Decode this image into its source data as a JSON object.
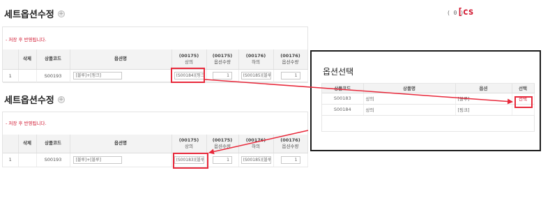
{
  "section_top": {
    "title": "세트옵션수정",
    "counter": "( 0 )",
    "cs_label": "[cs",
    "notice": "- 저장 후 반영됩니다.",
    "headers": {
      "delete": "삭제",
      "product_code": "상품코드",
      "option_name": "옵션명",
      "top_code": "(00175)",
      "top_label": "상의",
      "top_qty_code": "(00175)",
      "top_qty_label": "옵션수량",
      "bottom_code": "(00176)",
      "bottom_label": "하의",
      "bottom_qty_code": "(00176)",
      "bottom_qty_label": "옵션수량"
    },
    "row": {
      "no": "1",
      "product_code": "S00193",
      "option_value": "[블루]+[핑크]",
      "top_select": "(S00184)[핑크]",
      "top_qty": "1",
      "bottom_select": "(S00185)[블루]",
      "bottom_qty": "1"
    }
  },
  "section_bottom": {
    "title": "세트옵션수정",
    "notice": "- 저장 후 반영됩니다.",
    "headers": {
      "delete": "삭제",
      "product_code": "상품코드",
      "option_name": "옵션명",
      "top_code": "(00175)",
      "top_label": "상의",
      "top_qty_code": "(00175)",
      "top_qty_label": "옵션수량",
      "bottom_code": "(00176)",
      "bottom_label": "하의",
      "bottom_qty_code": "(00176)",
      "bottom_qty_label": "옵션수량"
    },
    "row": {
      "no": "1",
      "product_code": "S00193",
      "option_value": "[블루]+[블루]",
      "top_select": "(S00183)[블루]",
      "top_qty": "1",
      "bottom_select": "(S00185)[블루]",
      "bottom_qty": "1"
    }
  },
  "popup": {
    "title": "옵션선택",
    "headers": {
      "product_code": "상품코드",
      "product_name": "상품명",
      "option": "옵션",
      "select": "선택"
    },
    "rows": [
      {
        "code": "S00183",
        "name": "상의",
        "option": "[블루]",
        "select": "선택"
      },
      {
        "code": "S00184",
        "name": "상의",
        "option": "[핑크]",
        "select": ""
      }
    ]
  },
  "colors": {
    "highlight": "#e8283a",
    "notice_red": "#d0122b",
    "header_bg": "#f3f3f3"
  }
}
